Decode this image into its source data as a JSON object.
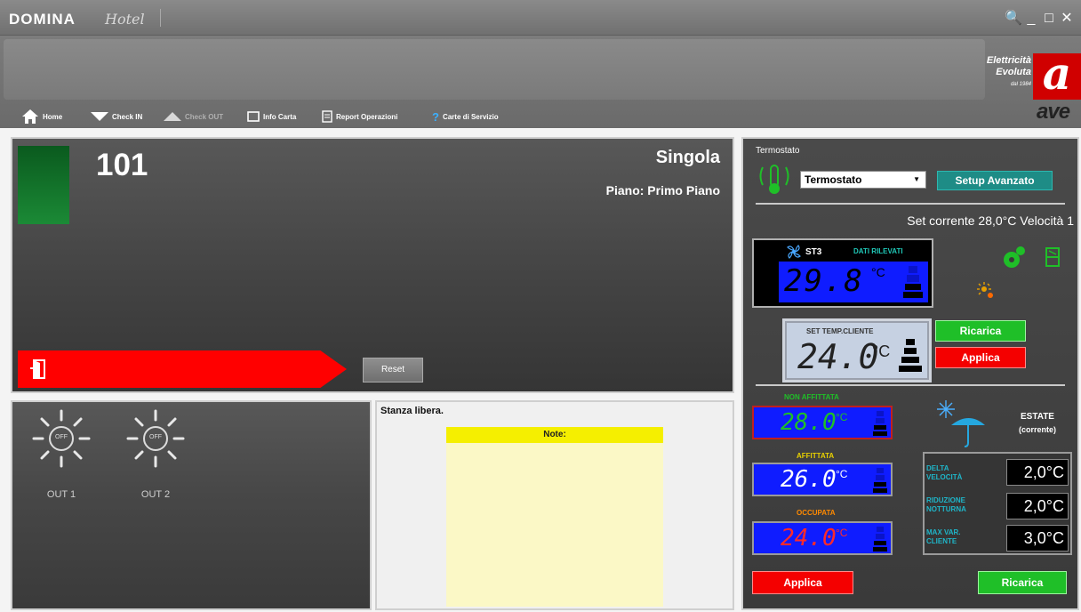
{
  "app": {
    "brand": "DOMINA",
    "brand_sub": "Hotel",
    "window_controls": [
      "🔍",
      "_",
      "□",
      "✕"
    ]
  },
  "logo": {
    "line1": "Elettricità",
    "line2": "Evoluta",
    "since": "dal 1984",
    "letter": "a",
    "word": "ave"
  },
  "nav": {
    "home": "Home",
    "checkin": "Check IN",
    "checkout": "Check OUT",
    "info_carta": "Info Carta",
    "report": "Report Operazioni",
    "carte": "Carte di Servizio"
  },
  "room": {
    "number": "101",
    "type": "Singola",
    "floor": "Piano: Primo Piano",
    "reset_label": "Reset",
    "status_color": "#ff0000"
  },
  "outputs": [
    {
      "badge": "OFF",
      "label": "OUT 1"
    },
    {
      "badge": "OFF",
      "label": "OUT 2"
    }
  ],
  "notes": {
    "status": "Stanza libera.",
    "header": "Note:"
  },
  "thermostat": {
    "title": "Termostato",
    "select_value": "Termostato",
    "setup_label": "Setup Avanzato",
    "set_current": "Set corrente 28,0°C Velocità 1",
    "st3_label": "ST3",
    "dati_label": "DATI RILEVATI",
    "measured_temp": "29.8",
    "measured_unit": "°C",
    "set_title": "SET TEMP.CLIENTE",
    "set_temp": "24.0",
    "set_unit": "°C",
    "ricarica_label": "Ricarica",
    "applica_label": "Applica",
    "non_affittata_label": "NON AFFITTATA",
    "non_affittata_temp": "28.0",
    "affittata_label": "AFFITTATA",
    "affittata_temp": "26.0",
    "occupata_label": "OCCUPATA",
    "occupata_temp": "24.0",
    "mode_unit": "°C",
    "season": "ESTATE",
    "season_note": "(corrente)",
    "params": [
      {
        "label": "DELTA VELOCITÀ",
        "value": "2,0°C"
      },
      {
        "label": "RIDUZIONE NOTTURNA",
        "value": "2,0°C"
      },
      {
        "label": "MAX VAR. CLIENTE",
        "value": "3,0°C"
      }
    ],
    "bottom_applica": "Applica",
    "bottom_ricarica": "Ricarica"
  }
}
